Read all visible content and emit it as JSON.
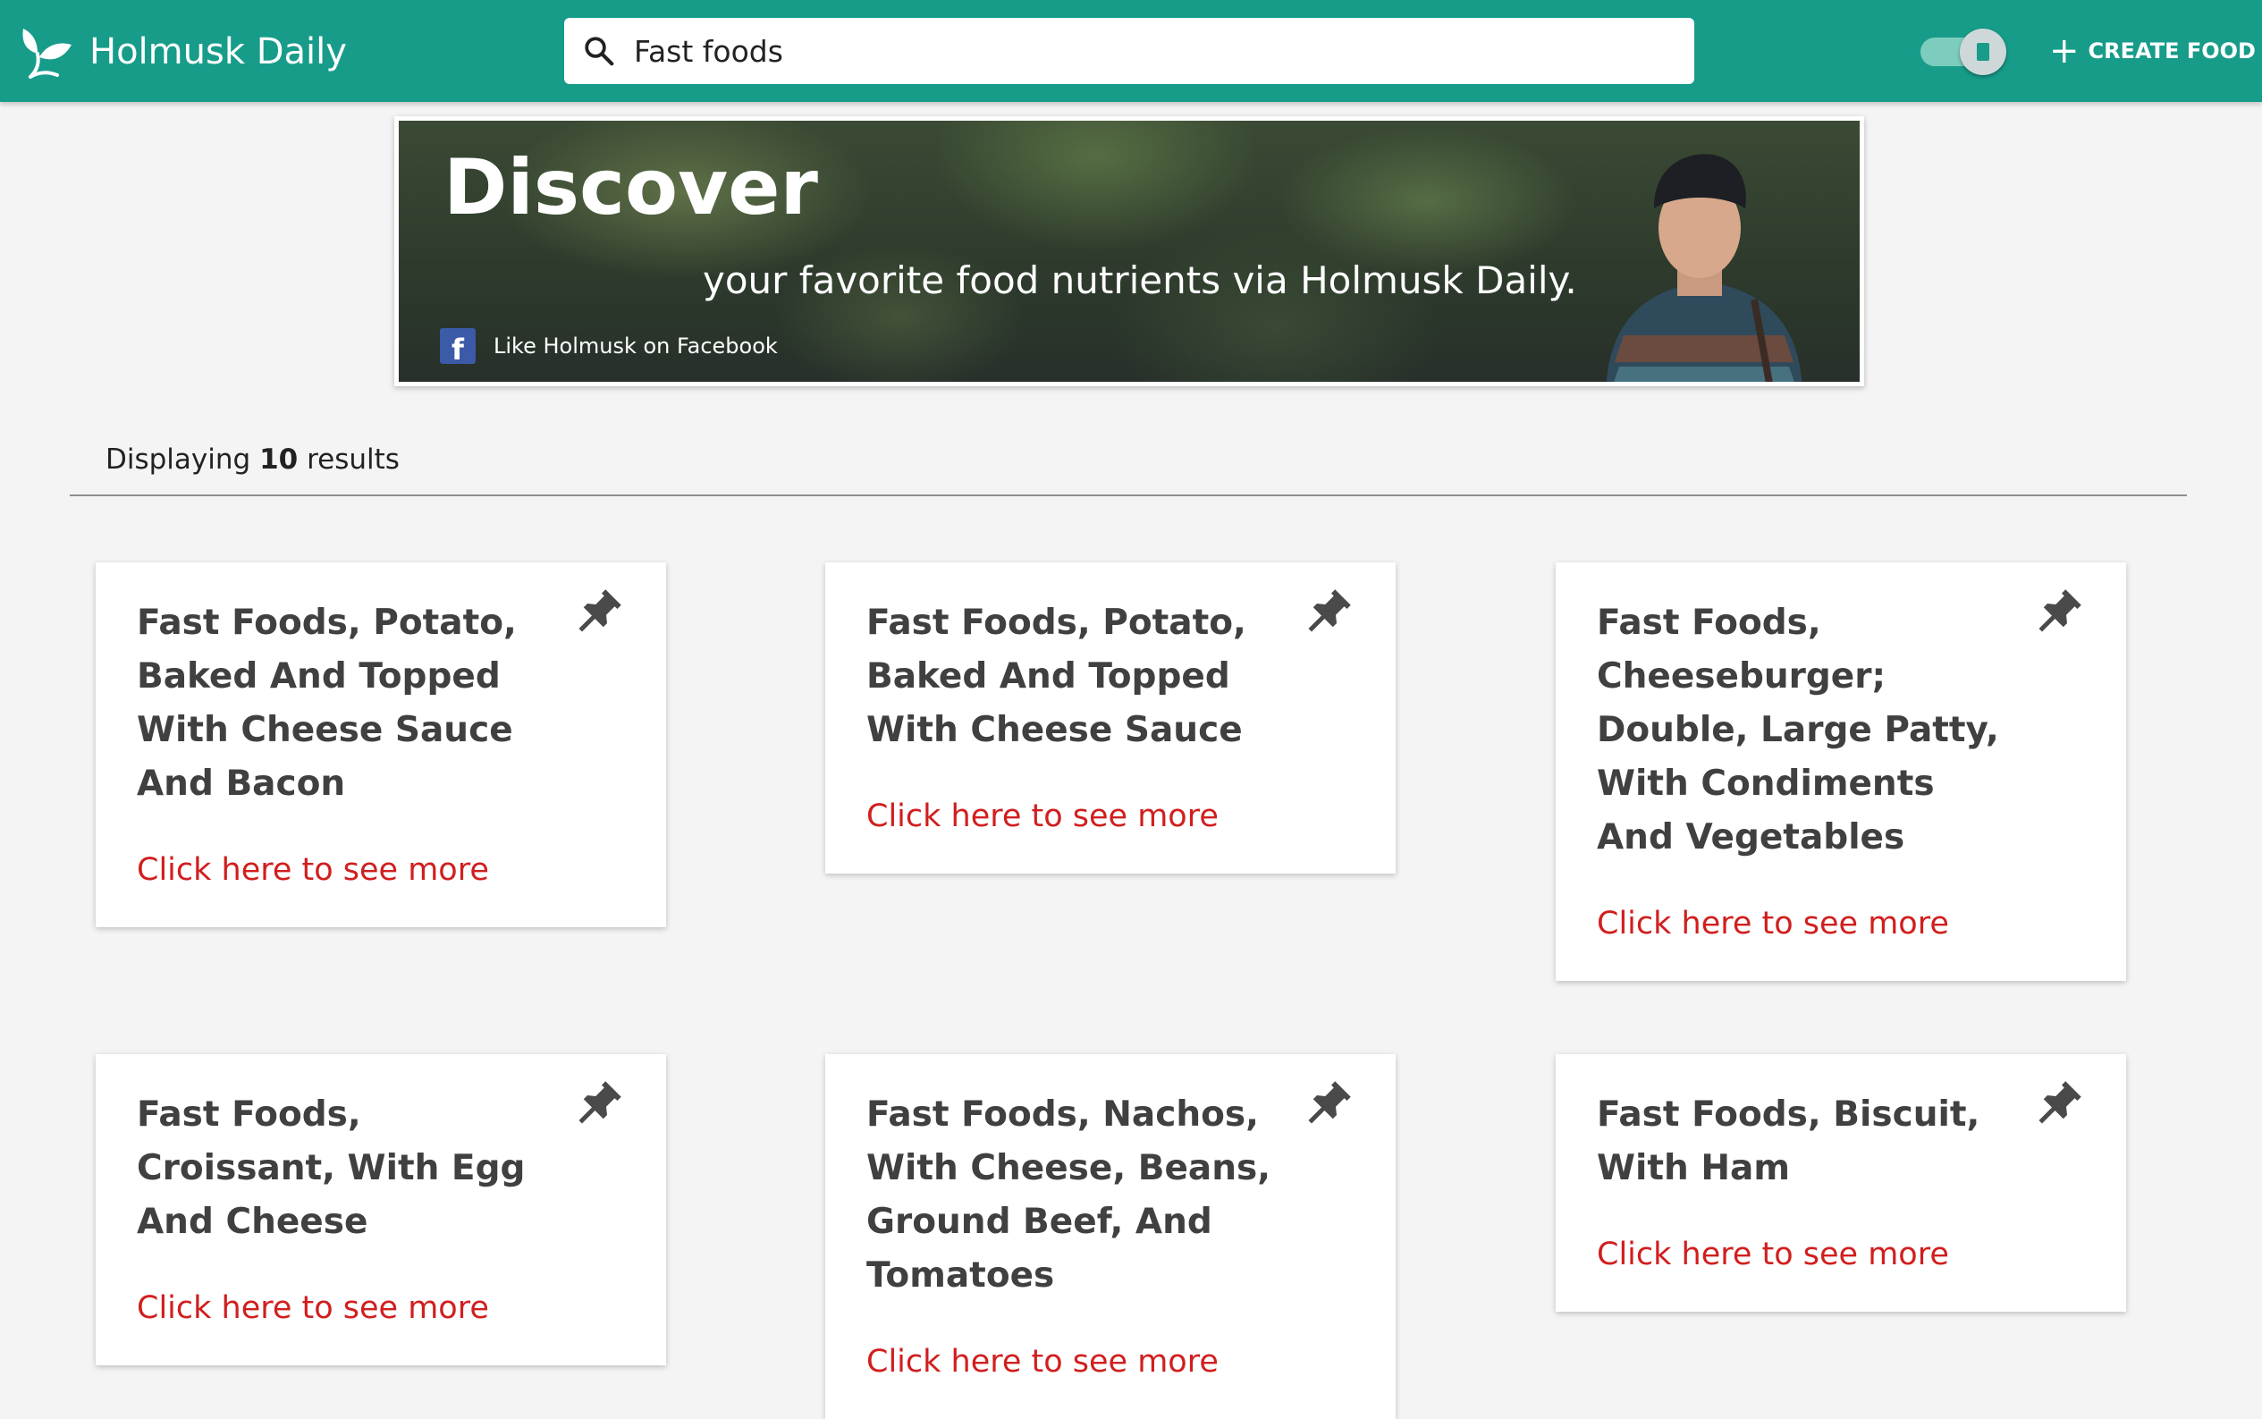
{
  "app": {
    "name": "Holmusk Daily"
  },
  "header": {
    "search_value": "Fast foods",
    "create_label": "CREATE FOOD"
  },
  "banner": {
    "title": "Discover",
    "subtitle": "your favorite food nutrients via Holmusk Daily.",
    "facebook_label": "Like Holmusk on Facebook",
    "facebook_glyph": "f"
  },
  "results": {
    "prefix": "Displaying",
    "count": "10",
    "suffix": "results"
  },
  "cards": [
    {
      "title": "Fast Foods, Potato, Baked And Topped With Cheese Sauce And Bacon",
      "link": "Click here to see more"
    },
    {
      "title": "Fast Foods, Potato, Baked And Topped With Cheese Sauce",
      "link": "Click here to see more"
    },
    {
      "title": "Fast Foods, Cheeseburger; Double, Large Patty, With Condiments And Vegetables",
      "link": "Click here to see more"
    },
    {
      "title": "Fast Foods, Croissant, With Egg And Cheese",
      "link": "Click here to see more"
    },
    {
      "title": "Fast Foods, Nachos, With Cheese, Beans, Ground Beef, And Tomatoes",
      "link": "Click here to see more"
    },
    {
      "title": "Fast Foods, Biscuit, With Ham",
      "link": "Click here to see more"
    }
  ],
  "colors": {
    "brand": "#179c8a",
    "link": "#d11e1e",
    "background": "#f4f4f4"
  },
  "icons": {
    "logo": "leaf-logo-icon",
    "search": "search-icon",
    "create": "plus-icon",
    "pin": "pin-icon",
    "facebook": "facebook-icon"
  }
}
